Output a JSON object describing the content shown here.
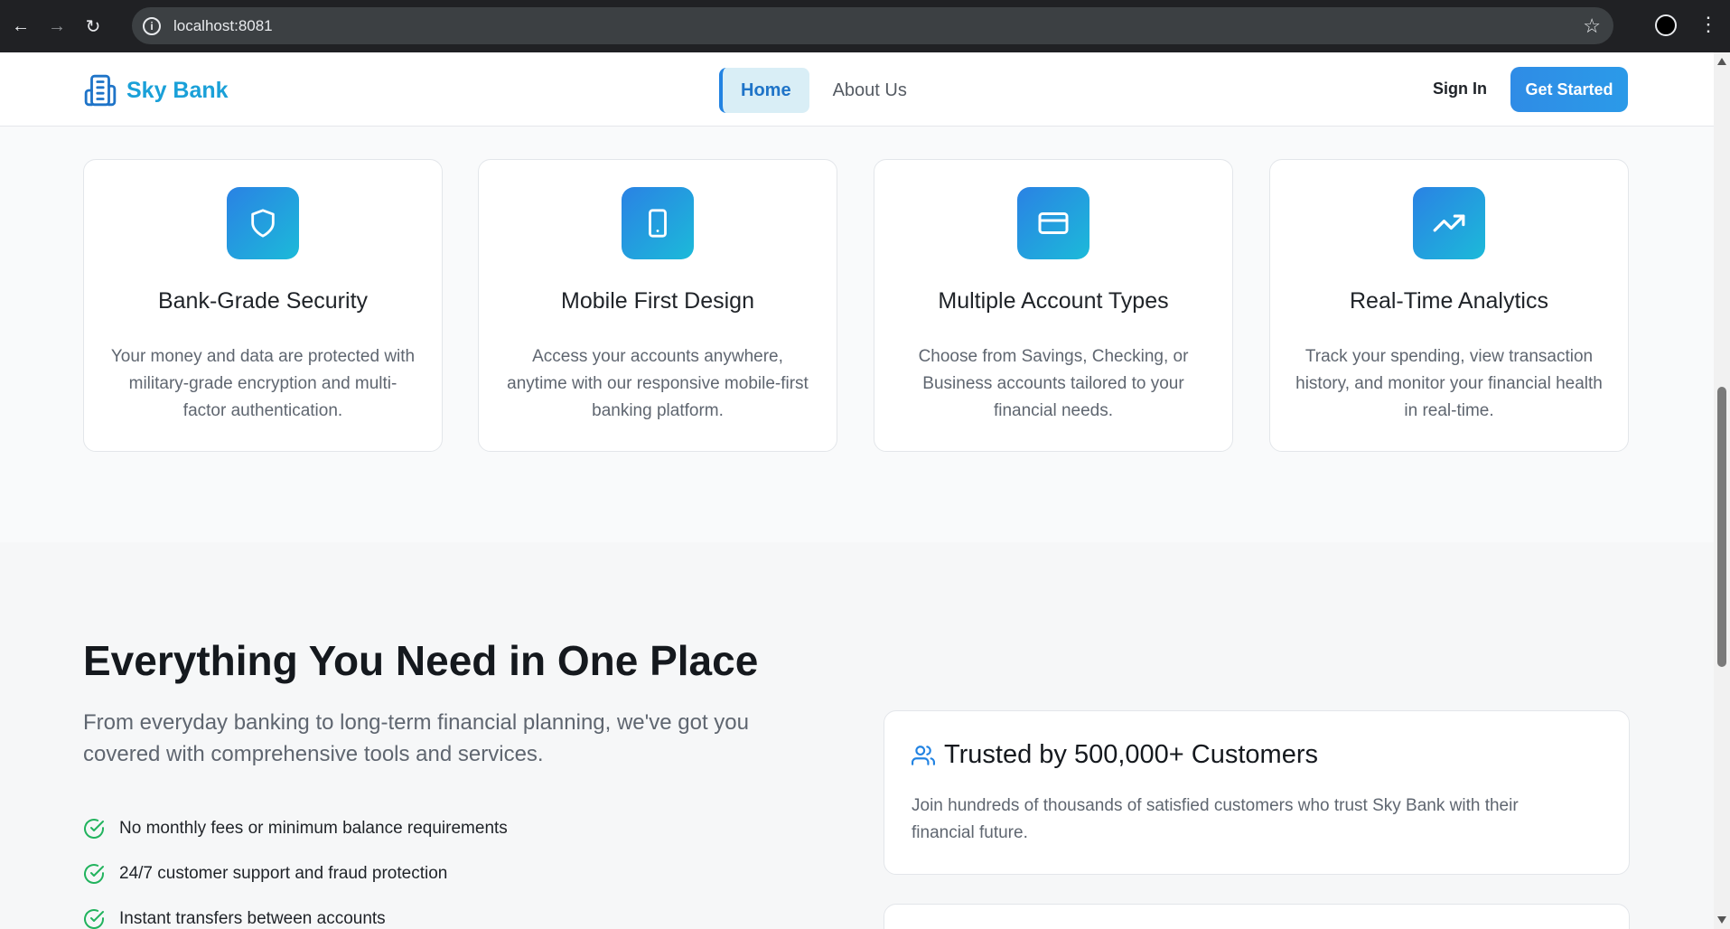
{
  "browser": {
    "url": "localhost:8081"
  },
  "header": {
    "brand": "Sky Bank",
    "nav": [
      {
        "label": "Home",
        "active": true
      },
      {
        "label": "About Us",
        "active": false
      }
    ],
    "sign_in": "Sign In",
    "get_started": "Get Started"
  },
  "features": [
    {
      "icon": "shield-icon",
      "title": "Bank-Grade Security",
      "desc": "Your money and data are protected with military-grade encryption and multi-factor authentication."
    },
    {
      "icon": "smartphone-icon",
      "title": "Mobile First Design",
      "desc": "Access your accounts anywhere, anytime with our responsive mobile-first banking platform."
    },
    {
      "icon": "credit-card-icon",
      "title": "Multiple Account Types",
      "desc": "Choose from Savings, Checking, or Business accounts tailored to your financial needs."
    },
    {
      "icon": "trending-up-icon",
      "title": "Real-Time Analytics",
      "desc": "Track your spending, view transaction history, and monitor your financial health in real-time."
    }
  ],
  "everything": {
    "title": "Everything You Need in One Place",
    "subtitle": "From everyday banking to long-term financial planning, we've got you covered with comprehensive tools and services.",
    "checklist": [
      "No monthly fees or minimum balance requirements",
      "24/7 customer support and fraud protection",
      "Instant transfers between accounts"
    ],
    "trust_card": {
      "title": "Trusted by 500,000+ Customers",
      "desc": "Join hundreds of thousands of satisfied customers who trust Sky Bank with their financial future."
    }
  },
  "colors": {
    "brand": "#1aa0d8",
    "primary": "#2f8ce6",
    "accent_green": "#22b35e"
  }
}
